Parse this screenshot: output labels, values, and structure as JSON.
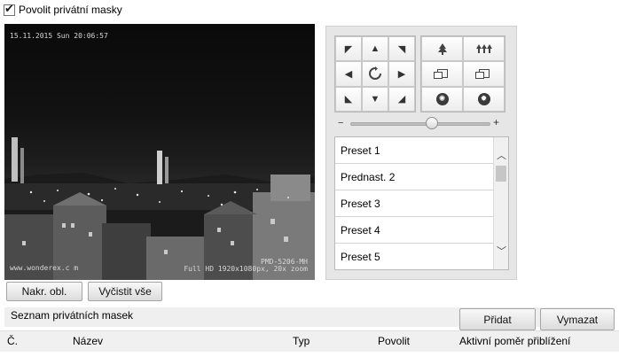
{
  "enable": {
    "label": "Povolit privátní masky",
    "checked": true
  },
  "video": {
    "timestamp": "15.11.2015 Sun 20:06:57",
    "site": "www.wonderex.c m",
    "camera": "PMD-5206-MH",
    "resolution": "Full HD 1920x1080px, 20x zoom"
  },
  "ptz": {
    "directions": [
      "◤",
      "▲",
      "◥",
      "◀",
      "auto",
      "▶",
      "◣",
      "▼",
      "◢"
    ],
    "speed_minus": "−",
    "speed_plus": "+",
    "speed_level": 0.58,
    "presets": [
      "Preset 1",
      "Prednast. 2",
      "Preset 3",
      "Preset 4",
      "Preset 5"
    ]
  },
  "buttons": {
    "draw_area": "Nakr. obl.",
    "clear_all": "Vyčistit vše"
  },
  "mask_list": {
    "title": "Seznam privátních masek",
    "add": "Přidat",
    "delete": "Vymazat",
    "columns": [
      "Č.",
      "Název",
      "Typ",
      "Povolit",
      "Aktivní poměr přiblížení"
    ]
  },
  "colors": {
    "panel_bg": "#e6e6e6",
    "header_bg": "#f0f0f0"
  }
}
